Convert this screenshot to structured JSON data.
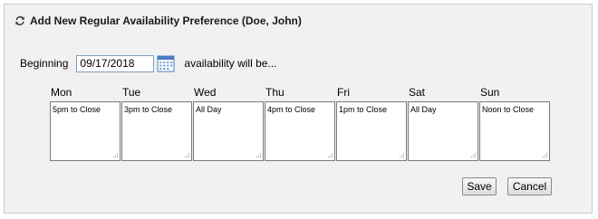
{
  "header": {
    "title": "Add New Regular Availability Preference (Doe, John)",
    "icon": "refresh-icon"
  },
  "beginning": {
    "label": "Beginning",
    "date_value": "09/17/2018",
    "calendar_icon": "calendar-icon",
    "suffix": "availability will be..."
  },
  "days": [
    {
      "name": "Mon",
      "value": "5pm to Close"
    },
    {
      "name": "Tue",
      "value": "3pm to Close"
    },
    {
      "name": "Wed",
      "value": "All Day"
    },
    {
      "name": "Thu",
      "value": "4pm to Close"
    },
    {
      "name": "Fri",
      "value": "1pm to Close"
    },
    {
      "name": "Sat",
      "value": "All Day"
    },
    {
      "name": "Sun",
      "value": "Noon to Close"
    }
  ],
  "buttons": {
    "save_label": "Save",
    "cancel_label": "Cancel"
  },
  "colors": {
    "panel_bg": "#f1f1f1",
    "input_border": "#7f9db9",
    "calendar_accent": "#4a7cc2"
  }
}
